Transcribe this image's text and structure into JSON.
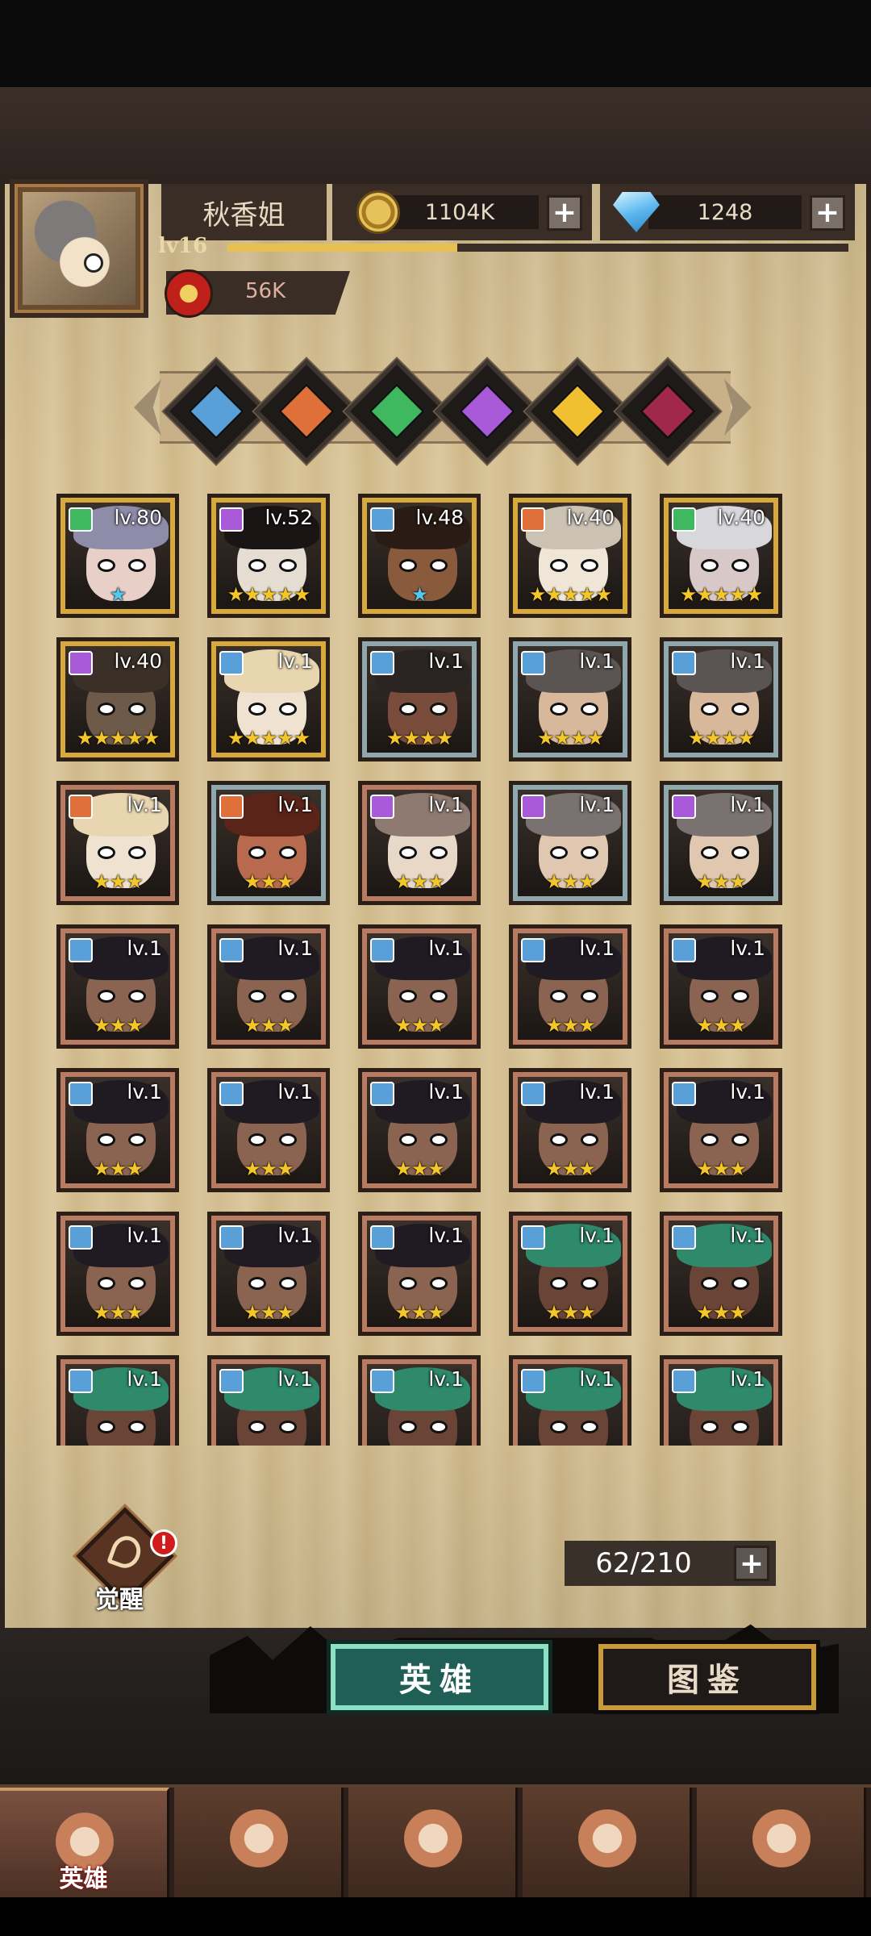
{
  "player": {
    "name": "秋香姐",
    "level": "lv16",
    "xp_fraction": 0.37,
    "power": "56K"
  },
  "resources": {
    "gold": "1104K",
    "gems": "1248"
  },
  "factions": [
    {
      "icon": "sword-faction-icon",
      "color": "#5aa0d8"
    },
    {
      "icon": "sun-faction-icon",
      "color": "#e0703a"
    },
    {
      "icon": "clover-faction-icon",
      "color": "#3fb860"
    },
    {
      "icon": "orb-faction-icon",
      "color": "#a85ad8"
    },
    {
      "icon": "light-faction-icon",
      "color": "#f0c030"
    },
    {
      "icon": "dark-faction-icon",
      "color": "#a0284a"
    }
  ],
  "heroes": [
    {
      "level": "lv.80",
      "stars": "★",
      "star_color": "blue",
      "frame": "gold",
      "element": "#3fb860",
      "hair": "#8f8caa",
      "skin": "#e8d0c8"
    },
    {
      "level": "lv.52",
      "stars": "★★★★★",
      "star_color": "gold",
      "frame": "gold",
      "element": "#a85ad8",
      "hair": "#1a1414",
      "skin": "#e6ddd2"
    },
    {
      "level": "lv.48",
      "stars": "★",
      "star_color": "blue",
      "frame": "gold",
      "element": "#5aa0d8",
      "hair": "#2a1c14",
      "skin": "#8a5a3c"
    },
    {
      "level": "lv.40",
      "stars": "★★★★★",
      "star_color": "gold",
      "frame": "gold",
      "element": "#e0703a",
      "hair": "#cbc2b4",
      "skin": "#efe6d8"
    },
    {
      "level": "lv.40",
      "stars": "★★★★★",
      "star_color": "gold",
      "frame": "gold",
      "element": "#3fb860",
      "hair": "#d8d8dc",
      "skin": "#d8c8c8"
    },
    {
      "level": "lv.40",
      "stars": "★★★★★",
      "star_color": "gold",
      "frame": "gold",
      "element": "#a85ad8",
      "hair": "#3a3028",
      "skin": "#6e5a48"
    },
    {
      "level": "lv.1",
      "stars": "★★★★★",
      "star_color": "gold",
      "frame": "gold",
      "element": "#5aa0d8",
      "hair": "#e8d6b0",
      "skin": "#f0e2d0"
    },
    {
      "level": "lv.1",
      "stars": "★★★★",
      "star_color": "gold",
      "frame": "silver",
      "element": "#5aa0d8",
      "hair": "#2a2422",
      "skin": "#7a4c3c"
    },
    {
      "level": "lv.1",
      "stars": "★★★★",
      "star_color": "gold",
      "frame": "silver",
      "element": "#5aa0d8",
      "hair": "#5a5452",
      "skin": "#d8b89a"
    },
    {
      "level": "lv.1",
      "stars": "★★★★",
      "star_color": "gold",
      "frame": "silver",
      "element": "#5aa0d8",
      "hair": "#5a5452",
      "skin": "#d8b89a"
    },
    {
      "level": "lv.1",
      "stars": "★★★",
      "star_color": "gold",
      "frame": "bronze",
      "element": "#e0703a",
      "hair": "#e8d6b0",
      "skin": "#f0e2d0"
    },
    {
      "level": "lv.1",
      "stars": "★★★",
      "star_color": "gold",
      "frame": "silver",
      "element": "#e0703a",
      "hair": "#5a2418",
      "skin": "#b86a4e"
    },
    {
      "level": "lv.1",
      "stars": "★★★",
      "star_color": "gold",
      "frame": "bronze",
      "element": "#a85ad8",
      "hair": "#8e7a70",
      "skin": "#e8d8c8"
    },
    {
      "level": "lv.1",
      "stars": "★★★",
      "star_color": "gold",
      "frame": "silver",
      "element": "#a85ad8",
      "hair": "#7a7270",
      "skin": "#e0c8b0"
    },
    {
      "level": "lv.1",
      "stars": "★★★",
      "star_color": "gold",
      "frame": "silver",
      "element": "#a85ad8",
      "hair": "#7a7270",
      "skin": "#e0c8b0"
    },
    {
      "level": "lv.1",
      "stars": "★★★",
      "star_color": "gold",
      "frame": "bronze",
      "element": "#5aa0d8",
      "hair": "#201a22",
      "skin": "#8a6450"
    },
    {
      "level": "lv.1",
      "stars": "★★★",
      "star_color": "gold",
      "frame": "bronze",
      "element": "#5aa0d8",
      "hair": "#201a22",
      "skin": "#8a6450"
    },
    {
      "level": "lv.1",
      "stars": "★★★",
      "star_color": "gold",
      "frame": "bronze",
      "element": "#5aa0d8",
      "hair": "#201a22",
      "skin": "#8a6450"
    },
    {
      "level": "lv.1",
      "stars": "★★★",
      "star_color": "gold",
      "frame": "bronze",
      "element": "#5aa0d8",
      "hair": "#201a22",
      "skin": "#8a6450"
    },
    {
      "level": "lv.1",
      "stars": "★★★",
      "star_color": "gold",
      "frame": "bronze",
      "element": "#5aa0d8",
      "hair": "#201a22",
      "skin": "#8a6450"
    },
    {
      "level": "lv.1",
      "stars": "★★★",
      "star_color": "gold",
      "frame": "bronze",
      "element": "#5aa0d8",
      "hair": "#201a22",
      "skin": "#8a6450"
    },
    {
      "level": "lv.1",
      "stars": "★★★",
      "star_color": "gold",
      "frame": "bronze",
      "element": "#5aa0d8",
      "hair": "#201a22",
      "skin": "#8a6450"
    },
    {
      "level": "lv.1",
      "stars": "★★★",
      "star_color": "gold",
      "frame": "bronze",
      "element": "#5aa0d8",
      "hair": "#201a22",
      "skin": "#8a6450"
    },
    {
      "level": "lv.1",
      "stars": "★★★",
      "star_color": "gold",
      "frame": "bronze",
      "element": "#5aa0d8",
      "hair": "#201a22",
      "skin": "#8a6450"
    },
    {
      "level": "lv.1",
      "stars": "★★★",
      "star_color": "gold",
      "frame": "bronze",
      "element": "#5aa0d8",
      "hair": "#201a22",
      "skin": "#8a6450"
    },
    {
      "level": "lv.1",
      "stars": "★★★",
      "star_color": "gold",
      "frame": "bronze",
      "element": "#5aa0d8",
      "hair": "#201a22",
      "skin": "#8a6450"
    },
    {
      "level": "lv.1",
      "stars": "★★★",
      "star_color": "gold",
      "frame": "bronze",
      "element": "#5aa0d8",
      "hair": "#201a22",
      "skin": "#8a6450"
    },
    {
      "level": "lv.1",
      "stars": "★★★",
      "star_color": "gold",
      "frame": "bronze",
      "element": "#5aa0d8",
      "hair": "#201a22",
      "skin": "#8a6450"
    },
    {
      "level": "lv.1",
      "stars": "★★★",
      "star_color": "gold",
      "frame": "bronze",
      "element": "#5aa0d8",
      "hair": "#2e8a6a",
      "skin": "#6a4436"
    },
    {
      "level": "lv.1",
      "stars": "★★★",
      "star_color": "gold",
      "frame": "bronze",
      "element": "#5aa0d8",
      "hair": "#2e8a6a",
      "skin": "#6a4436"
    },
    {
      "level": "lv.1",
      "stars": "",
      "star_color": "gold",
      "frame": "bronze",
      "element": "#5aa0d8",
      "hair": "#2e8a6a",
      "skin": "#6a4436"
    },
    {
      "level": "lv.1",
      "stars": "",
      "star_color": "gold",
      "frame": "bronze",
      "element": "#5aa0d8",
      "hair": "#2e8a6a",
      "skin": "#6a4436"
    },
    {
      "level": "lv.1",
      "stars": "",
      "star_color": "gold",
      "frame": "bronze",
      "element": "#5aa0d8",
      "hair": "#2e8a6a",
      "skin": "#6a4436"
    },
    {
      "level": "lv.1",
      "stars": "",
      "star_color": "gold",
      "frame": "bronze",
      "element": "#5aa0d8",
      "hair": "#2e8a6a",
      "skin": "#6a4436"
    },
    {
      "level": "lv.1",
      "stars": "",
      "star_color": "gold",
      "frame": "bronze",
      "element": "#5aa0d8",
      "hair": "#2e8a6a",
      "skin": "#6a4436"
    }
  ],
  "awaken": {
    "label": "觉醒",
    "alert": "!"
  },
  "capacity": "62/210",
  "tabs": {
    "heroes": "英雄",
    "codex": "图鉴"
  },
  "bottom_nav": [
    {
      "icon": "helmet-icon",
      "label": "英雄",
      "active": true
    },
    {
      "icon": "banner-icon",
      "label": "",
      "active": false
    },
    {
      "icon": "crossed-swords-icon",
      "label": "",
      "active": false
    },
    {
      "icon": "castle-icon",
      "label": "",
      "active": false
    },
    {
      "icon": "guild-handshake-icon",
      "label": "",
      "active": false
    }
  ]
}
